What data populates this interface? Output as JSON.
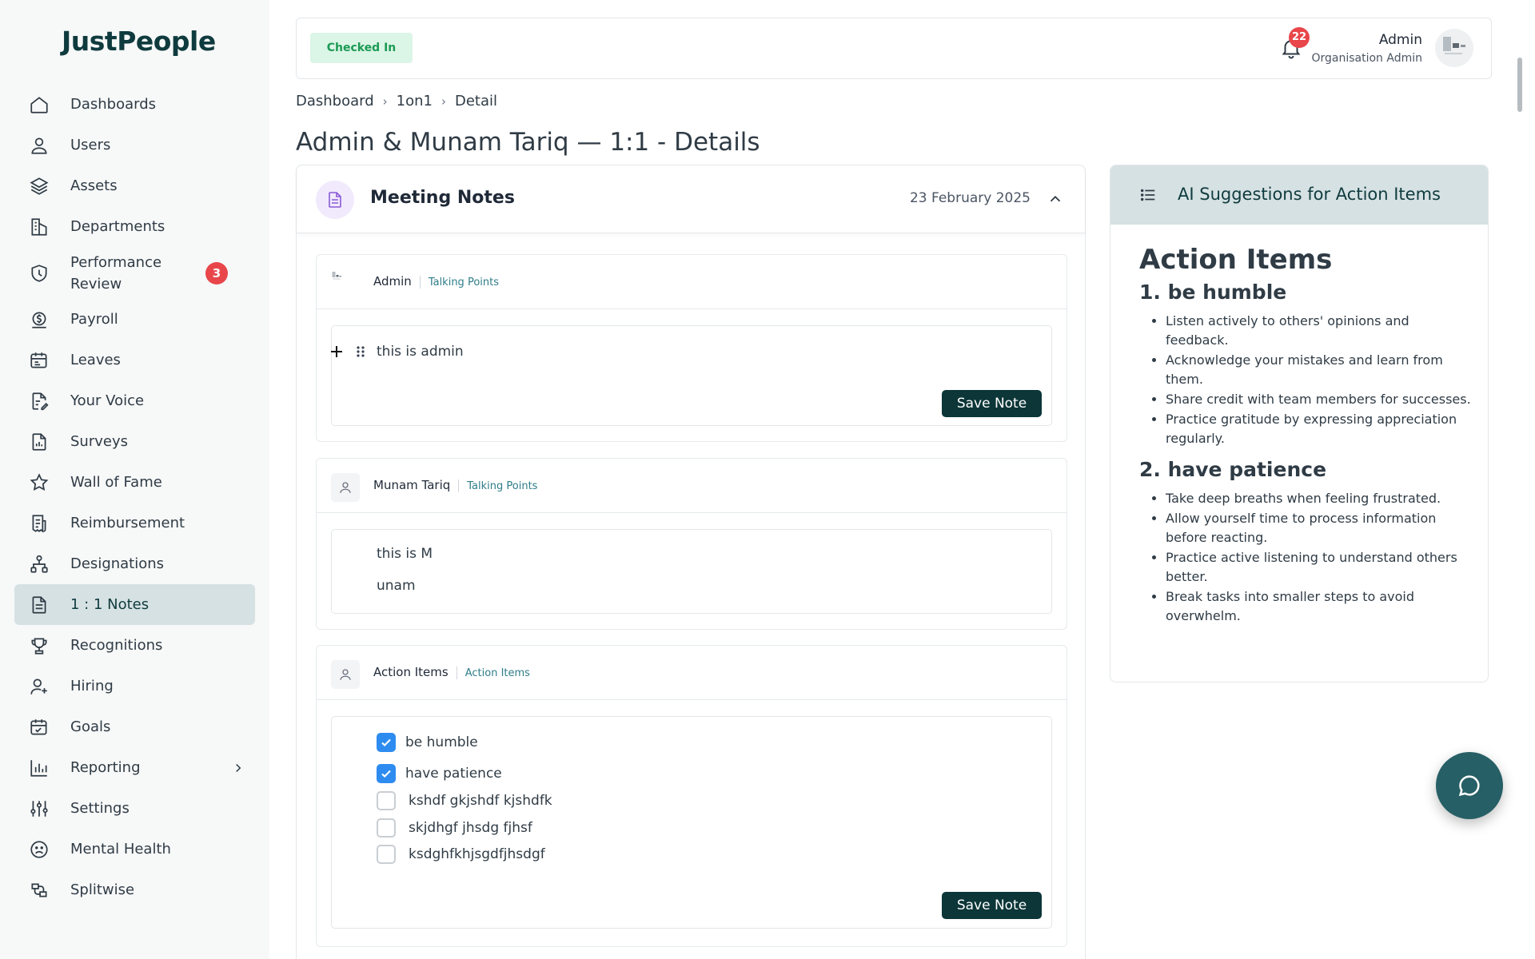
{
  "app": {
    "logo": "JustPeople"
  },
  "sidebar": {
    "items": [
      {
        "label": "Dashboards",
        "icon": "home-icon"
      },
      {
        "label": "Users",
        "icon": "user-icon"
      },
      {
        "label": "Assets",
        "icon": "layers-icon"
      },
      {
        "label": "Departments",
        "icon": "building-icon"
      },
      {
        "label": "Performance Review",
        "icon": "shield-icon",
        "badge": "3"
      },
      {
        "label": "Payroll",
        "icon": "dollar-icon"
      },
      {
        "label": "Leaves",
        "icon": "calendar-icon"
      },
      {
        "label": "Your Voice",
        "icon": "file-edit-icon"
      },
      {
        "label": "Surveys",
        "icon": "file-chart-icon"
      },
      {
        "label": "Wall of Fame",
        "icon": "star-icon"
      },
      {
        "label": "Reimbursement",
        "icon": "receipt-icon"
      },
      {
        "label": "Designations",
        "icon": "hierarchy-icon"
      },
      {
        "label": "1 : 1 Notes",
        "icon": "notes-icon",
        "active": true
      },
      {
        "label": "Recognitions",
        "icon": "trophy-icon"
      },
      {
        "label": "Hiring",
        "icon": "user-plus-icon"
      },
      {
        "label": "Goals",
        "icon": "calendar-check-icon"
      },
      {
        "label": "Reporting",
        "icon": "bar-chart-icon"
      },
      {
        "label": "Settings",
        "icon": "sliders-icon"
      },
      {
        "label": "Mental Health",
        "icon": "sad-face-icon"
      },
      {
        "label": "Splitwise",
        "icon": "split-icon"
      }
    ]
  },
  "topbar": {
    "status": "Checked In",
    "notifications": "22",
    "user_name": "Admin",
    "user_role": "Organisation Admin"
  },
  "breadcrumb": [
    "Dashboard",
    "1on1",
    "Detail"
  ],
  "page_title": "Admin & Munam Tariq — 1:1 - Details",
  "meeting": {
    "title": "Meeting Notes",
    "date": "23 February 2025",
    "sections": [
      {
        "name": "Admin",
        "tag": "Talking Points",
        "lines": [
          "this is admin"
        ],
        "save_label": "Save Note"
      },
      {
        "name": "Munam Tariq",
        "tag": "Talking Points",
        "lines": [
          "this is M",
          "unam"
        ]
      },
      {
        "name": "Action Items",
        "tag": "Action Items",
        "save_label": "Save Note",
        "checklist": [
          {
            "label": "be humble",
            "checked": true
          },
          {
            "label": "have patience",
            "checked": true
          },
          {
            "label": "kshdf gkjshdf kjshdfk",
            "checked": false
          },
          {
            "label": "skjdhgf jhsdg fjhsf",
            "checked": false
          },
          {
            "label": "ksdghfkhjsgdfjhsdgf",
            "checked": false
          }
        ]
      }
    ]
  },
  "ai": {
    "header": "AI Suggestions for Action Items",
    "heading": "Action Items",
    "groups": [
      {
        "title": "1. be humble",
        "items": [
          "Listen actively to others' opinions and feedback.",
          "Acknowledge your mistakes and learn from them.",
          "Share credit with team members for successes.",
          "Practice gratitude by expressing appreciation regularly."
        ]
      },
      {
        "title": "2. have patience",
        "items": [
          "Take deep breaths when feeling frustrated.",
          "Allow yourself time to process information before reacting.",
          "Practice active listening to understand others better.",
          "Break tasks into smaller steps to avoid overwhelm."
        ]
      }
    ]
  },
  "colors": {
    "brand": "#0f3b3e",
    "active_bg": "#d6e1e3",
    "badge": "#e8464a",
    "check": "#2e8cf0",
    "status_bg": "#dbf5e6"
  }
}
